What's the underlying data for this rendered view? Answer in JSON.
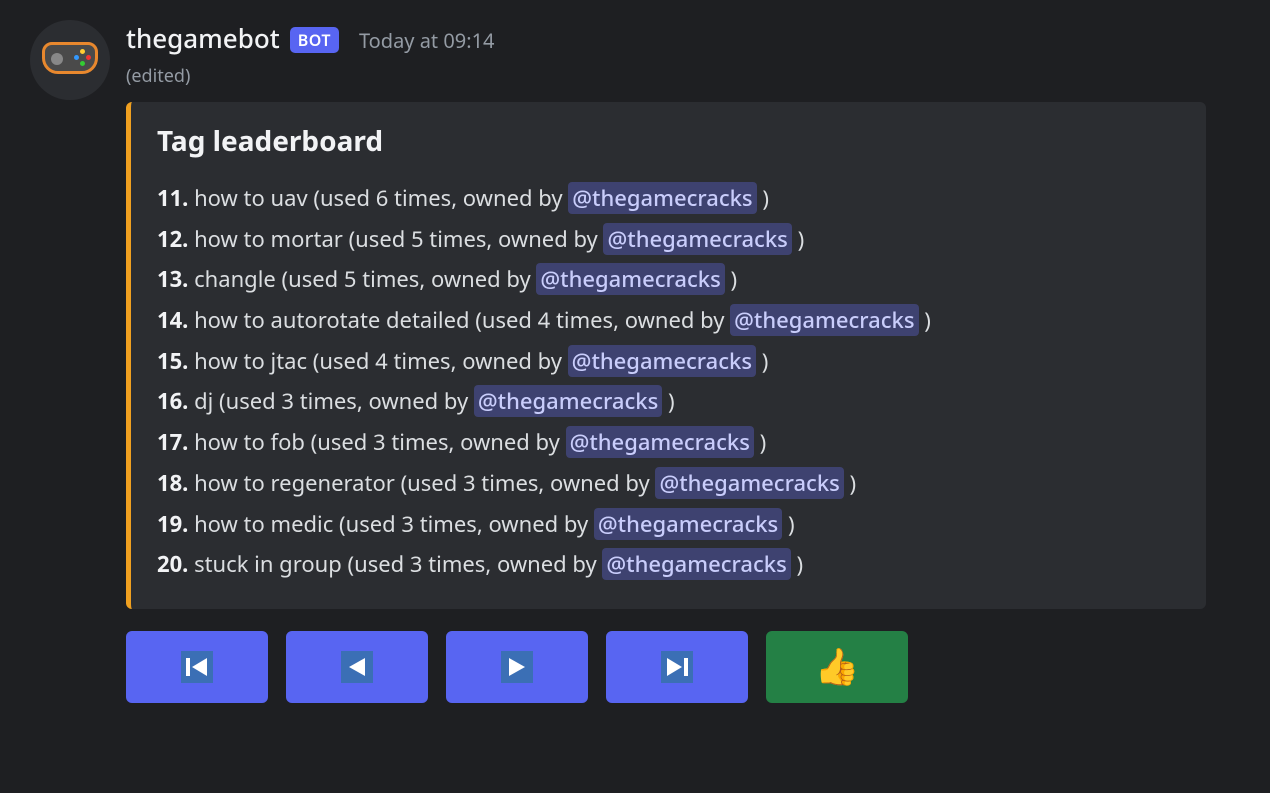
{
  "message": {
    "username": "thegamebot",
    "bot_label": "BOT",
    "timestamp": "Today at 09:14",
    "edited_label": "(edited)"
  },
  "embed": {
    "title": "Tag leaderboard",
    "accent_color": "#f0a020",
    "owner_mention": "@thegamecracks",
    "entries": [
      {
        "rank": "11.",
        "name": "how to uav",
        "uses": 6
      },
      {
        "rank": "12.",
        "name": "how to mortar",
        "uses": 5
      },
      {
        "rank": "13.",
        "name": "changle",
        "uses": 5
      },
      {
        "rank": "14.",
        "name": "how to autorotate detailed",
        "uses": 4
      },
      {
        "rank": "15.",
        "name": "how to jtac",
        "uses": 4
      },
      {
        "rank": "16.",
        "name": "dj",
        "uses": 3
      },
      {
        "rank": "17.",
        "name": "how to fob",
        "uses": 3
      },
      {
        "rank": "18.",
        "name": "how to regenerator",
        "uses": 3
      },
      {
        "rank": "19.",
        "name": "how to medic",
        "uses": 3
      },
      {
        "rank": "20.",
        "name": "stuck in group",
        "uses": 3
      }
    ]
  },
  "buttons": {
    "first": "⏮",
    "prev": "◀",
    "next": "▶",
    "last": "⏭",
    "ok": "👍"
  }
}
